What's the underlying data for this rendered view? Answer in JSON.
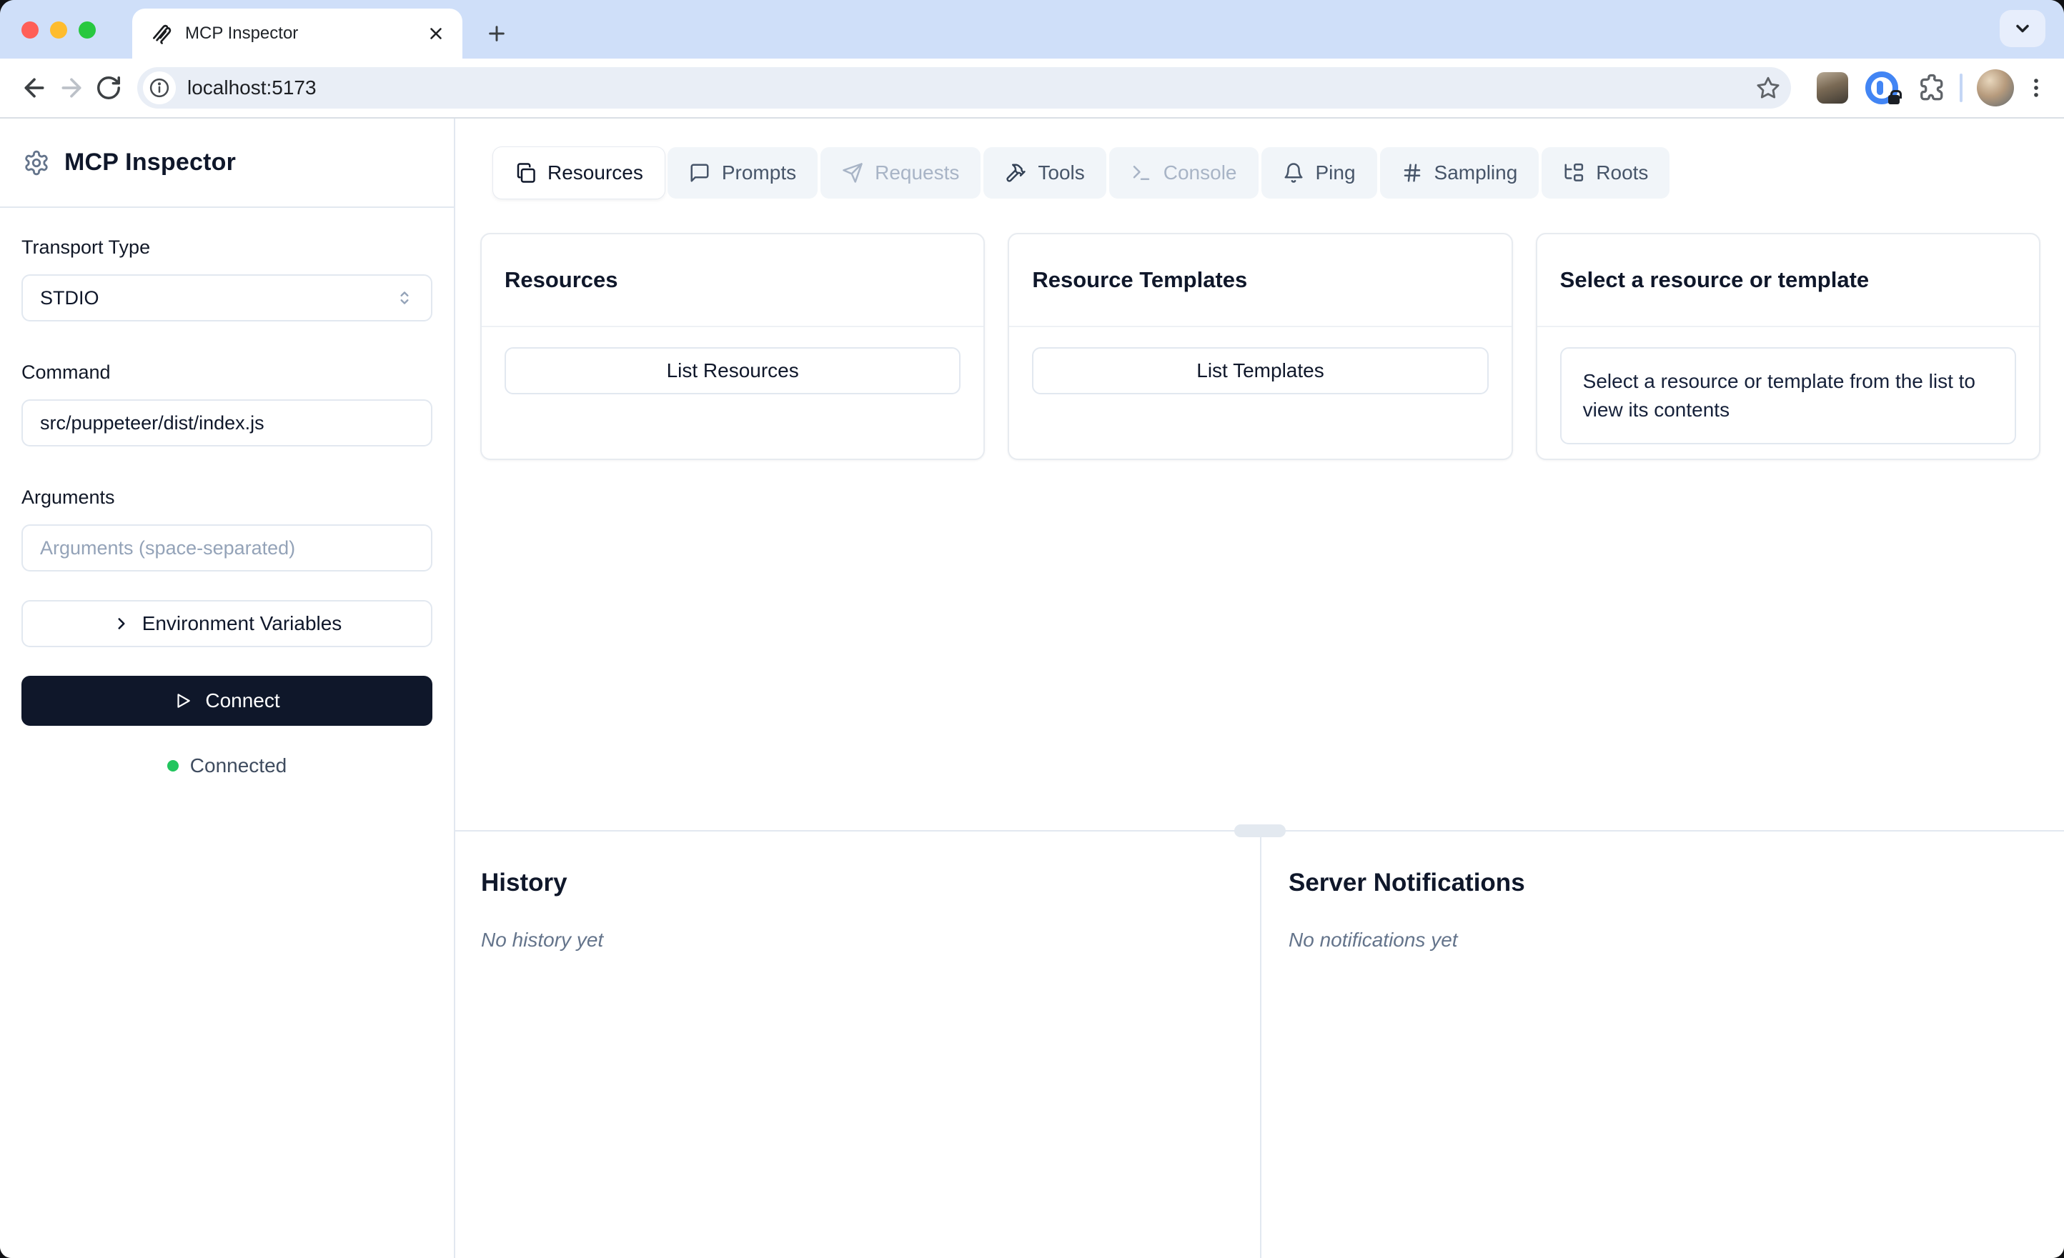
{
  "browser": {
    "tab_title": "MCP Inspector",
    "url": "localhost:5173"
  },
  "sidebar": {
    "app_title": "MCP Inspector",
    "transport_label": "Transport Type",
    "transport_value": "STDIO",
    "command_label": "Command",
    "command_value": "src/puppeteer/dist/index.js",
    "arguments_label": "Arguments",
    "arguments_placeholder": "Arguments (space-separated)",
    "env_button_label": "Environment Variables",
    "connect_button_label": "Connect",
    "status_text": "Connected"
  },
  "tabs": [
    {
      "label": "Resources",
      "icon": "files-icon",
      "state": "active"
    },
    {
      "label": "Prompts",
      "icon": "message-square-icon",
      "state": "enabled"
    },
    {
      "label": "Requests",
      "icon": "send-icon",
      "state": "disabled"
    },
    {
      "label": "Tools",
      "icon": "hammer-icon",
      "state": "enabled"
    },
    {
      "label": "Console",
      "icon": "terminal-icon",
      "state": "disabled"
    },
    {
      "label": "Ping",
      "icon": "bell-icon",
      "state": "enabled"
    },
    {
      "label": "Sampling",
      "icon": "hash-icon",
      "state": "enabled"
    },
    {
      "label": "Roots",
      "icon": "folder-tree-icon",
      "state": "enabled"
    }
  ],
  "cards": {
    "resources": {
      "title": "Resources",
      "button_label": "List Resources"
    },
    "templates": {
      "title": "Resource Templates",
      "button_label": "List Templates"
    },
    "selection": {
      "title": "Select a resource or template",
      "message": "Select a resource or template from the list to view its contents"
    }
  },
  "bottom_panels": {
    "history_title": "History",
    "history_empty": "No history yet",
    "notifications_title": "Server Notifications",
    "notifications_empty": "No notifications yet"
  },
  "colors": {
    "connected_green": "#22c55e",
    "connect_button_bg": "#0f172a",
    "tabstrip_blue": "#cfdff9",
    "traffic_red": "#ff5f57",
    "traffic_yellow": "#febc2e",
    "traffic_green": "#28c840",
    "border": "#e2e8f0",
    "disabled_text": "#a8b4c6"
  }
}
